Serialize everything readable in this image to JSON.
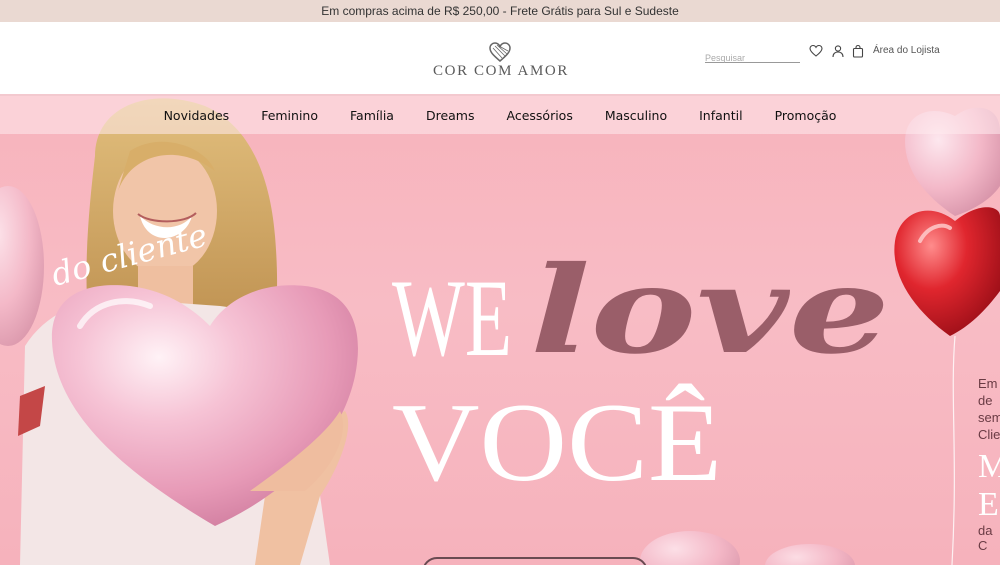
{
  "topbar": {
    "text": "Em compras acima de R$ 250,00 - Frete Grátis para Sul e Sudeste"
  },
  "header": {
    "logo_text": "COR COM AMOR",
    "search_placeholder": "Pesquisar",
    "lojista": "Área do Lojista",
    "icons": [
      "heart-icon",
      "user-icon",
      "bag-icon"
    ]
  },
  "nav": {
    "items": [
      "Novidades",
      "Feminino",
      "Família",
      "Dreams",
      "Acessórios",
      "Masculino",
      "Infantil",
      "Promoção"
    ]
  },
  "hero": {
    "script_small": "do cliente",
    "headline_we": "WE",
    "headline_love": "love",
    "headline_voce": "VOCÊ",
    "right_lines": [
      "Em",
      "de",
      "sem",
      "Clie"
    ],
    "right_big": [
      "M",
      "ES"
    ],
    "right_small": "da C"
  },
  "colors": {
    "topbar": "#ead9d2",
    "hero": "#f7b6bf",
    "love": "#9a5e69",
    "accent": "#f3c9cf"
  }
}
